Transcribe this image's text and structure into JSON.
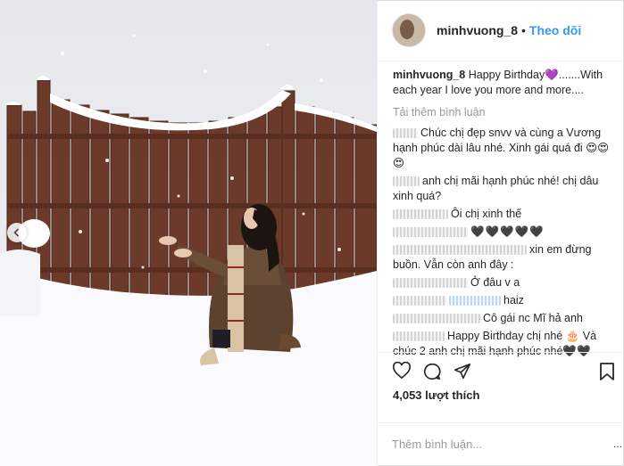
{
  "post": {
    "username": "minhvuong_8",
    "separator": "•",
    "follow_label": "Theo dõi"
  },
  "caption": {
    "username": "minhvuong_8",
    "text": "Happy Birthday💜.......With each year I love you more and more...."
  },
  "load_more": "Tải thêm bình luận",
  "comments": [
    {
      "text": "Chúc chị đẹp snvv và cùng a Vương hạnh phúc dài lâu nhé. Xinh gái quá đi 😍😍😍"
    },
    {
      "text": "anh chị mãi hạnh phúc nhé! chị dâu xinh quá?"
    },
    {
      "text": "Ôi chị xinh thế"
    },
    {
      "text": "🖤🖤🖤🖤🖤"
    },
    {
      "text": "xin em đừng buồn. Vẫn còn anh đây :"
    },
    {
      "text": "Ở đâu v a"
    },
    {
      "text": "haiz"
    },
    {
      "text": "Cô gái nc Mĩ hả anh"
    },
    {
      "text": "Happy Birthday chị nhé 🎂 Và chúc 2 anh chị mãi hạnh phúc nhé🖤🖤"
    }
  ],
  "likes": "4,053 lượt thích",
  "add_comment_placeholder": "Thêm bình luận...",
  "more_label": "...",
  "icons": {
    "like": "heart-icon",
    "comment": "comment-icon",
    "share": "share-icon",
    "save": "bookmark-icon",
    "prev": "chevron-left-icon"
  }
}
